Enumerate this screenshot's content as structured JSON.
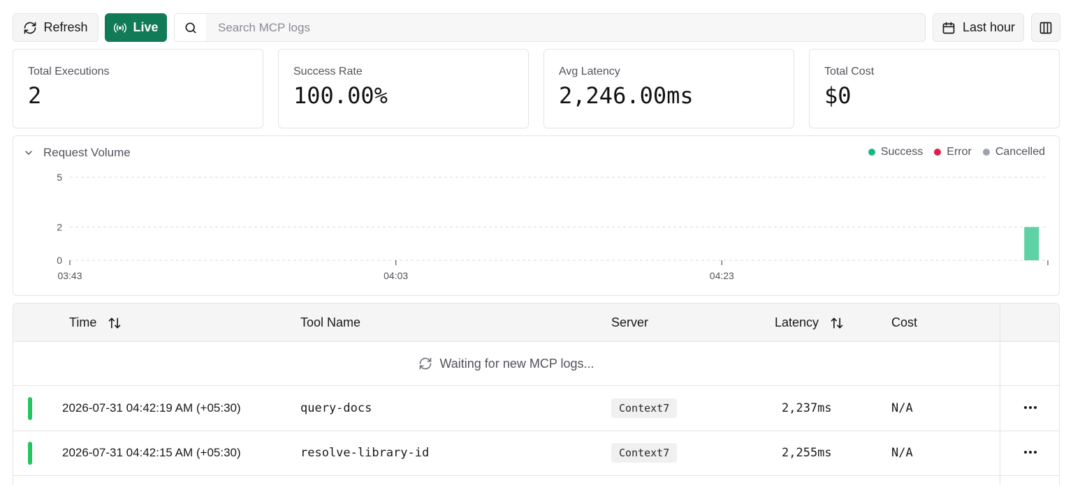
{
  "toolbar": {
    "refresh_label": "Refresh",
    "live_label": "Live",
    "search_placeholder": "Search MCP logs",
    "time_range_label": "Last hour"
  },
  "stats": [
    {
      "label": "Total Executions",
      "value": "2"
    },
    {
      "label": "Success Rate",
      "value": "100.00%"
    },
    {
      "label": "Avg Latency",
      "value": "2,246.00ms"
    },
    {
      "label": "Total Cost",
      "value": "$0"
    }
  ],
  "chart_panel": {
    "title": "Request Volume",
    "legend": [
      {
        "label": "Success",
        "color": "#10b981"
      },
      {
        "label": "Error",
        "color": "#e11d48"
      },
      {
        "label": "Cancelled",
        "color": "#9ca3af"
      }
    ]
  },
  "chart_data": {
    "type": "bar",
    "title": "Request Volume",
    "xlabel": "",
    "ylabel": "",
    "x_ticks": [
      "03:43",
      "04:03",
      "04:23"
    ],
    "y_ticks": [
      0,
      2,
      5
    ],
    "ylim": [
      0,
      5
    ],
    "x_range_minutes": [
      0,
      60
    ],
    "grid": true,
    "legend_position": "top-right",
    "series": [
      {
        "name": "Success",
        "color": "#5dd3a5",
        "points": [
          {
            "x_minute": 59,
            "value": 2
          }
        ]
      },
      {
        "name": "Error",
        "color": "#e11d48",
        "points": []
      },
      {
        "name": "Cancelled",
        "color": "#9ca3af",
        "points": []
      }
    ]
  },
  "table": {
    "headers": {
      "time": "Time",
      "tool_name": "Tool Name",
      "server": "Server",
      "latency": "Latency",
      "cost": "Cost"
    },
    "waiting_text": "Waiting for new MCP logs...",
    "rows": [
      {
        "time": "2026-07-31 04:42:19 AM (+05:30)",
        "tool_name": "query-docs",
        "server": "Context7",
        "latency": "2,237ms",
        "cost": "N/A",
        "status_color": "#22c55e"
      },
      {
        "time": "2026-07-31 04:42:15 AM (+05:30)",
        "tool_name": "resolve-library-id",
        "server": "Context7",
        "latency": "2,255ms",
        "cost": "N/A",
        "status_color": "#22c55e"
      }
    ]
  }
}
